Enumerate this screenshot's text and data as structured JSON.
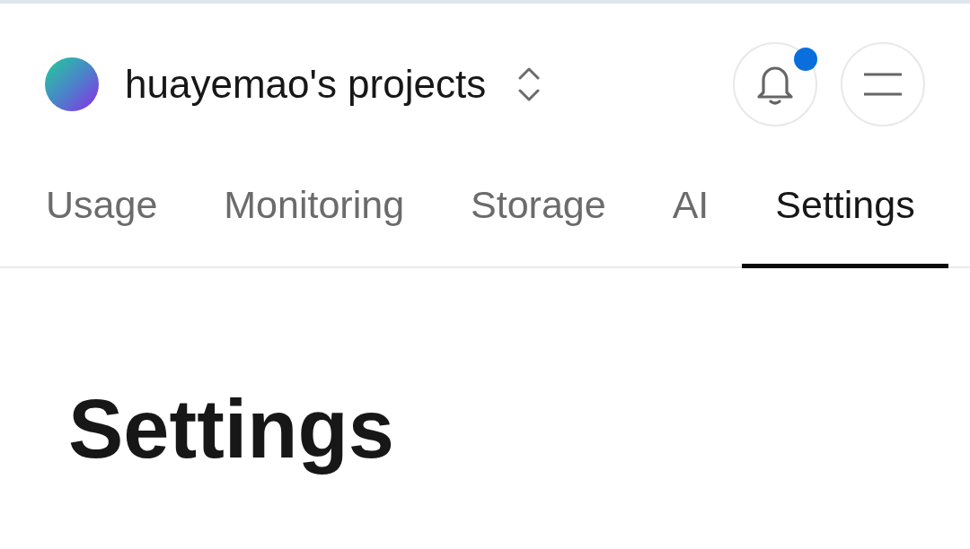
{
  "header": {
    "project_name": "huayemao's projects",
    "notifications": {
      "unread": true
    }
  },
  "tabs": [
    {
      "label": "Usage",
      "selected": false
    },
    {
      "label": "Monitoring",
      "selected": false
    },
    {
      "label": "Storage",
      "selected": false
    },
    {
      "label": "AI",
      "selected": false
    },
    {
      "label": "Settings",
      "selected": true
    }
  ],
  "page_title": "Settings"
}
